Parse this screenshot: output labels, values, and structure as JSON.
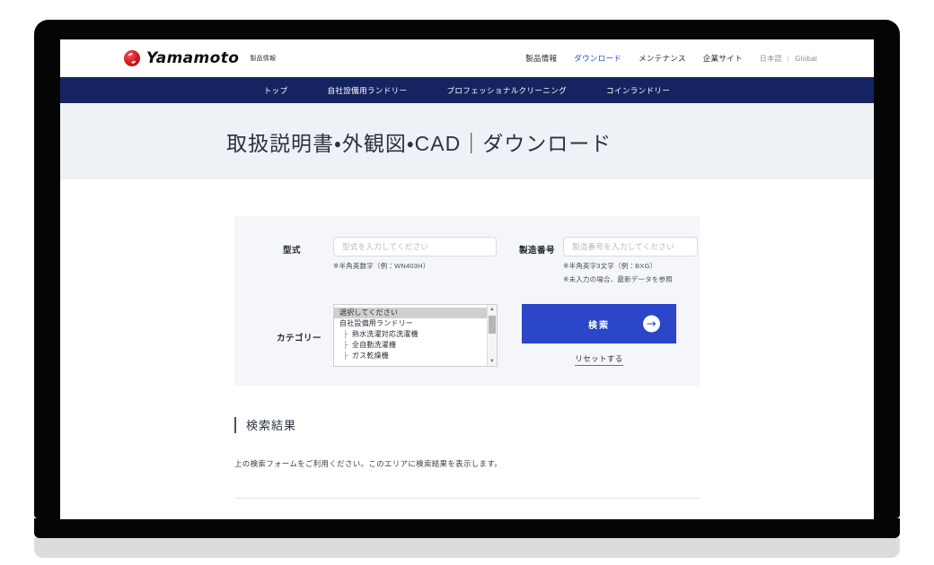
{
  "browser": {
    "device": "laptop-mockup"
  },
  "header": {
    "brand_name": "Yamamoto",
    "brand_sub": "製品情報",
    "logo_icon": "yamamoto-swirl-logo",
    "util_nav": [
      {
        "label": "製品情報",
        "active": false
      },
      {
        "label": "ダウンロード",
        "active": true
      },
      {
        "label": "メンテナンス",
        "active": false
      },
      {
        "label": "企業サイト",
        "active": false
      }
    ],
    "lang": {
      "current": "日本語",
      "separator": "|",
      "other": "Global"
    }
  },
  "main_nav": {
    "items": [
      {
        "label": "トップ"
      },
      {
        "label": "自社設備用ランドリー"
      },
      {
        "label": "プロフェッショナルクリーニング"
      },
      {
        "label": "コインランドリー"
      }
    ],
    "background": "#152461"
  },
  "hero": {
    "title": "取扱説明書・外観図・CAD｜ダウンロード",
    "background": "#eef2f7"
  },
  "search_form": {
    "model": {
      "label": "型式",
      "placeholder": "型式を入力してください",
      "value": "",
      "note": "※半角英数字（例：WN403H）"
    },
    "serial": {
      "label": "製造番号",
      "placeholder": "製造番号を入力してください",
      "value": "",
      "note1": "※半角英字3文字（例：BXG）",
      "note2": "※未入力の場合、最新データを参照"
    },
    "category": {
      "label": "カテゴリー",
      "selected": "選択してください",
      "options": [
        {
          "label": "選択してください",
          "level": 0,
          "selected": true
        },
        {
          "label": "自社設備用ランドリー",
          "level": 0,
          "selected": false
        },
        {
          "label": "熱水洗濯対応洗濯機",
          "level": 1,
          "selected": false
        },
        {
          "label": "全自動洗濯機",
          "level": 1,
          "selected": false
        },
        {
          "label": "ガス乾燥機",
          "level": 1,
          "selected": false
        }
      ],
      "tree_glyph": "├"
    },
    "submit": {
      "label": "検索",
      "icon": "arrow-right-icon",
      "color": "#2b46c8"
    },
    "reset": {
      "label": "リセットする"
    }
  },
  "results": {
    "heading": "検索結果",
    "empty_message": "上の検索フォームをご利用ください。このエリアに検索結果を表示します。"
  }
}
